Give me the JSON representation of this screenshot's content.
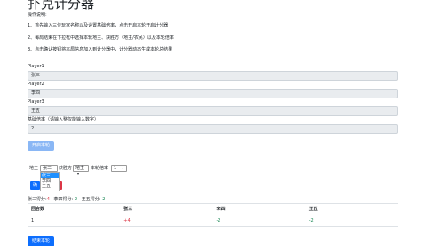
{
  "page": {
    "title": "扑克计分器",
    "instructions_heading": "操作说明:",
    "instructions": [
      "1、首先输入三位玩家名称以及设置基础倍率，点击开启本轮开启计分器",
      "2、每局结束在下拉框中选择本轮地主、获胜方（地主/农民）以及本轮倍率",
      "3、点击确认按钮将本局信息加入到计分器中，计分器动态生成本轮总结果"
    ]
  },
  "form": {
    "player1_label": "Player1",
    "player1_value": "张三",
    "player2_label": "Player2",
    "player2_value": "李四",
    "player3_label": "Player3",
    "player3_value": "王五",
    "base_rate_label": "基础倍率（请输入整仅能输入数字）",
    "base_rate_value": "2",
    "start_button": "开启本轮"
  },
  "controls": {
    "landlord_label": "地主",
    "landlord_selected": "张三",
    "winner_label": "获胜方",
    "winner_selected": "地主",
    "rate_label": "本轮倍率",
    "rate_selected": "1",
    "dropdown_options": [
      "张三",
      "李四",
      "王五"
    ],
    "confirm_button": "确",
    "cancel_button": "消"
  },
  "scores": {
    "summary": [
      {
        "name": "张三得分:",
        "value": "4",
        "color": "#dc3545"
      },
      {
        "name": "李四得分:",
        "value": "-2",
        "color": "#198754"
      },
      {
        "name": "王五得分:",
        "value": "-2",
        "color": "#198754"
      }
    ]
  },
  "table": {
    "headers": [
      "回合数",
      "张三",
      "李四",
      "王五"
    ],
    "rows": [
      {
        "round": "1",
        "p1": "+4",
        "p2": "-2",
        "p3": "-2"
      }
    ],
    "colors": {
      "positive": "#dc3545",
      "negative": "#198754"
    }
  },
  "end_button": "结束本轮"
}
